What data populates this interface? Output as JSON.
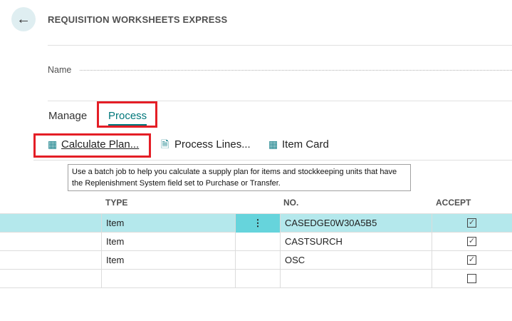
{
  "header": {
    "title": "REQUISITION WORKSHEETS EXPRESS",
    "back_icon": "arrow-left-icon"
  },
  "name_field": {
    "label": "Name",
    "value": ""
  },
  "tabs": [
    {
      "label": "Manage"
    },
    {
      "label": "Process",
      "active": true
    }
  ],
  "actions": [
    {
      "label": "Calculate Plan...",
      "icon": "calculate-plan-icon"
    },
    {
      "label": "Process Lines...",
      "icon": "process-lines-icon"
    },
    {
      "label": "Item Card",
      "icon": "item-card-icon"
    }
  ],
  "tooltip": "Use a batch job to help you calculate a supply plan for items and stockkeeping units that have the Replenishment System field set to Purchase or Transfer.",
  "table": {
    "columns": [
      "TYPE",
      "NO.",
      "ACCEPT"
    ],
    "rows": [
      {
        "type": "Item",
        "no": "CASEDGE0W30A5B5",
        "accept": true,
        "selected": true
      },
      {
        "type": "Item",
        "no": "CASTSURCH",
        "accept": true
      },
      {
        "type": "Item",
        "no": "OSC",
        "accept": true
      },
      {
        "type": "",
        "no": "",
        "accept": false
      }
    ]
  },
  "colors": {
    "accent": "#00777a",
    "selected_row": "#b4e8ec",
    "highlight": "#e41e26"
  }
}
